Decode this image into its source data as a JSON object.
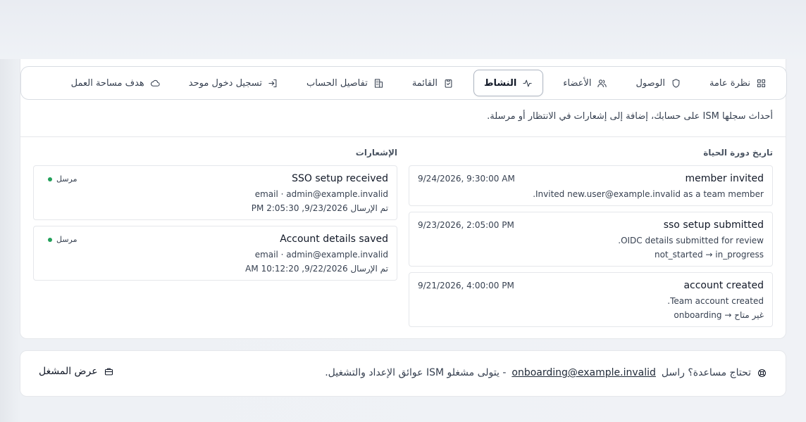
{
  "tabs": [
    {
      "label": "نظرة عامة",
      "icon": "grid-icon",
      "active": false
    },
    {
      "label": "الوصول",
      "icon": "shield-icon",
      "active": false
    },
    {
      "label": "الأعضاء",
      "icon": "users-icon",
      "active": false
    },
    {
      "label": "النشاط",
      "icon": "activity-icon",
      "active": true
    },
    {
      "label": "القائمة",
      "icon": "clipboard-check-icon",
      "active": false
    },
    {
      "label": "تفاصيل الحساب",
      "icon": "building-icon",
      "active": false
    },
    {
      "label": "تسجيل دخول موحد",
      "icon": "login-icon",
      "active": false
    },
    {
      "label": "هدف مساحة العمل",
      "icon": "cloud-icon",
      "active": false
    }
  ],
  "description": "أحداث سجلها ISM على حسابك، إضافة إلى إشعارات في الانتظار أو مرسلة.",
  "lifecycle": {
    "title": "تاريخ دورة الحياة",
    "items": [
      {
        "title": "member invited",
        "time": "9/24/2026, 9:30:00 AM",
        "detail": "Invited new.user@example.invalid as a team member.",
        "transition": ""
      },
      {
        "title": "sso setup submitted",
        "time": "9/23/2026, 2:05:00 PM",
        "detail": "OIDC details submitted for review.",
        "transition": "not_started → in_progress"
      },
      {
        "title": "account created",
        "time": "9/21/2026, 4:00:00 PM",
        "detail": "Team account created.",
        "transition": "غير متاح → onboarding"
      }
    ]
  },
  "notifications": {
    "title": "الإشعارات",
    "items": [
      {
        "title": "SSO setup received",
        "status": "مرسل",
        "channel": "email · admin@example.invalid",
        "sent": "تم الإرسال 9/23/2026, 2:05:30 PM"
      },
      {
        "title": "Account details saved",
        "status": "مرسل",
        "channel": "email · admin@example.invalid",
        "sent": "تم الإرسال 9/22/2026, 10:12:20 AM"
      }
    ]
  },
  "help": {
    "prefix": "تحتاج مساعدة؟ راسل",
    "email": "onboarding@example.invalid",
    "suffix": "- يتولى مشغلو ISM عوائق الإعداد والتشغيل.",
    "button_label": "عرض المشغل"
  },
  "colors": {
    "status_sent": "#22a05a"
  }
}
